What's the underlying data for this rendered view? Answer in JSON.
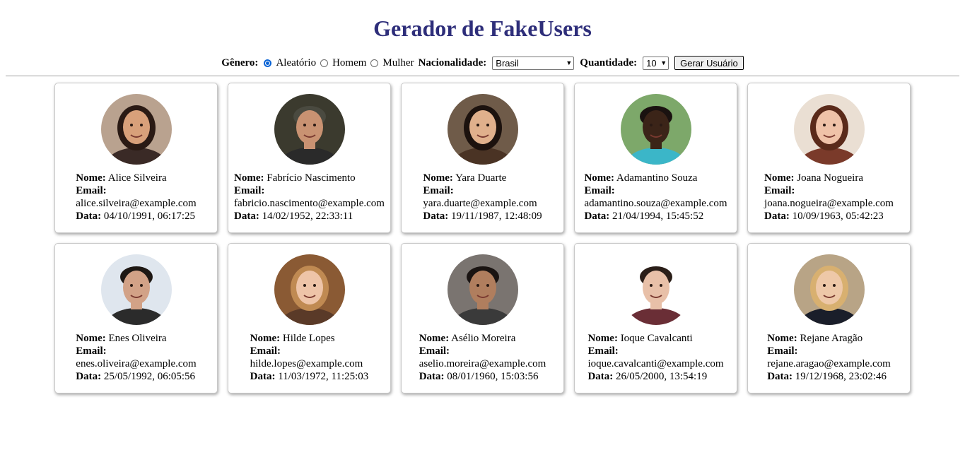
{
  "header": {
    "title": "Gerador de FakeUsers"
  },
  "controls": {
    "gender_label": "Gênero:",
    "gender_options": [
      "Aleatório",
      "Homem",
      "Mulher"
    ],
    "gender_selected": "Aleatório",
    "nationality_label": "Nacionalidade:",
    "nationality_value": "Brasil",
    "quantity_label": "Quantidade:",
    "quantity_value": "10",
    "generate_button": "Gerar Usuário"
  },
  "labels": {
    "name": "Nome:",
    "email": "Email:",
    "date": "Data:"
  },
  "users": [
    {
      "name": "Alice Silveira",
      "email": "alice.silveira@example.com",
      "date": "04/10/1991, 06:17:25",
      "photo": "woman-photo",
      "bg": "#b9a28f",
      "skin": "#d8a07a",
      "hair": "#2a1a14",
      "shirt": "#3a2a26"
    },
    {
      "name": "Fabrício Nascimento",
      "email": "fabricio.nascimento@example.com",
      "date": "14/02/1952, 22:33:11",
      "photo": "man-photo",
      "bg": "#3b3a2e",
      "skin": "#c99272",
      "hair": "#4a4a40",
      "shirt": "#2a2a2a"
    },
    {
      "name": "Yara Duarte",
      "email": "yara.duarte@example.com",
      "date": "19/11/1987, 12:48:09",
      "photo": "woman-photo",
      "bg": "#6f5b49",
      "skin": "#e0b08c",
      "hair": "#1c120e",
      "shirt": "#4a3324"
    },
    {
      "name": "Adamantino Souza",
      "email": "adamantino.souza@example.com",
      "date": "21/04/1994, 15:45:52",
      "photo": "man-photo",
      "bg": "#7da86a",
      "skin": "#3b2418",
      "hair": "#1a1210",
      "shirt": "#3bb6c8"
    },
    {
      "name": "Joana Nogueira",
      "email": "joana.nogueira@example.com",
      "date": "10/09/1963, 05:42:23",
      "photo": "woman-photo",
      "bg": "#eadfd3",
      "skin": "#efc2a8",
      "hair": "#5a2a1a",
      "shirt": "#7a3a2a"
    },
    {
      "name": "Enes Oliveira",
      "email": "enes.oliveira@example.com",
      "date": "25/05/1992, 06:05:56",
      "photo": "man-photo",
      "bg": "#dfe6ee",
      "skin": "#d2a287",
      "hair": "#1e1814",
      "shirt": "#2b2b2b"
    },
    {
      "name": "Hilde Lopes",
      "email": "hilde.lopes@example.com",
      "date": "11/03/1972, 11:25:03",
      "photo": "woman-photo",
      "bg": "#8a5a34",
      "skin": "#eec4a8",
      "hair": "#c08a52",
      "shirt": "#5a3a28"
    },
    {
      "name": "Asélio Moreira",
      "email": "aselio.moreira@example.com",
      "date": "08/01/1960, 15:03:56",
      "photo": "man-photo",
      "bg": "#7a7470",
      "skin": "#b07e5e",
      "hair": "#1a1412",
      "shirt": "#3a3a3a"
    },
    {
      "name": "Ioque Cavalcanti",
      "email": "ioque.cavalcanti@example.com",
      "date": "26/05/2000, 13:54:19",
      "photo": "man-photo",
      "bg": "#ffffff",
      "skin": "#e8c0a8",
      "hair": "#2a1e18",
      "shirt": "#6a2e36"
    },
    {
      "name": "Rejane Aragão",
      "email": "rejane.aragao@example.com",
      "date": "19/12/1968, 23:02:46",
      "photo": "woman-photo",
      "bg": "#b8a486",
      "skin": "#eec8a8",
      "hair": "#d8b070",
      "shirt": "#1a1e2a"
    }
  ]
}
